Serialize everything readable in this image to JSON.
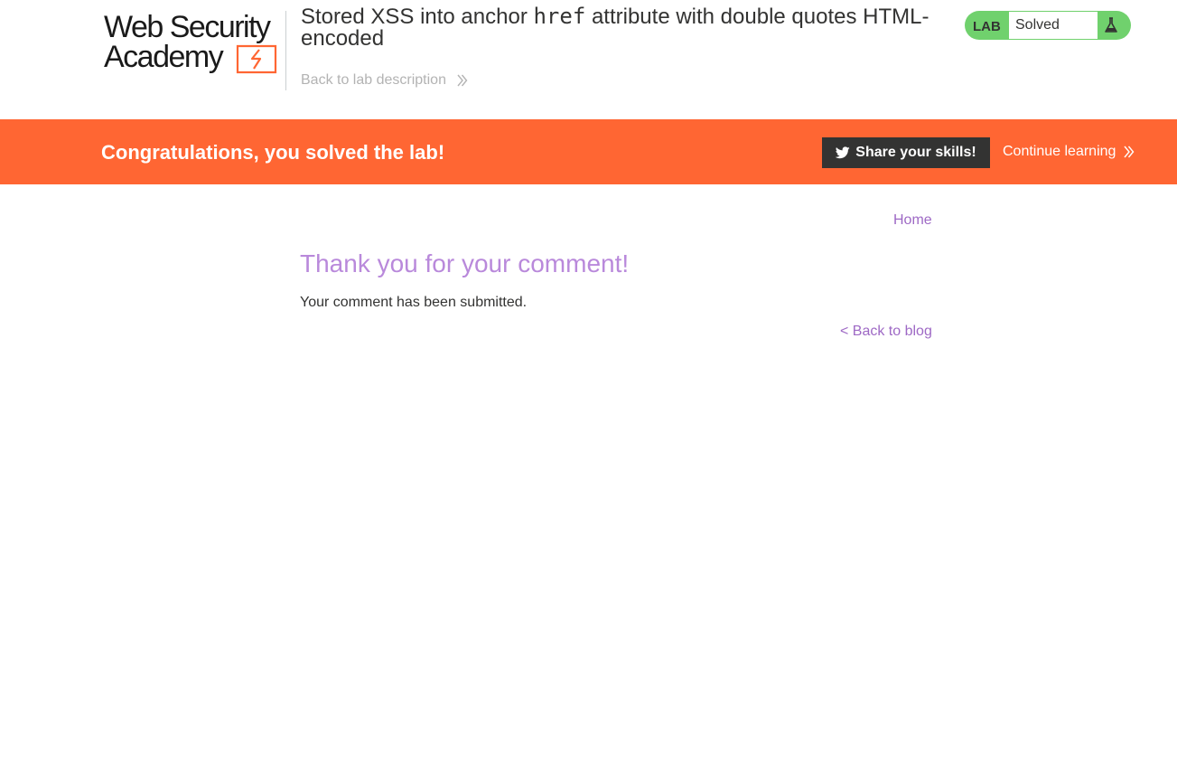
{
  "header": {
    "logo_line1": "Web Security",
    "logo_line2": "Academy",
    "lab_title_prefix": "Stored XSS into anchor ",
    "lab_title_code": "href",
    "lab_title_suffix": " attribute with double quotes HTML-encoded",
    "back_link": "Back to lab description"
  },
  "lab_status": {
    "label": "LAB",
    "value": "Solved",
    "icon": "flask-icon"
  },
  "banner": {
    "message": "Congratulations, you solved the lab!",
    "share_label": "Share your skills!",
    "share_icon": "twitter-icon",
    "continue_label": "Continue learning"
  },
  "nav": {
    "home": "Home"
  },
  "main": {
    "heading": "Thank you for your comment!",
    "message": "Your comment has been submitted.",
    "back_link": "< Back to blog"
  },
  "colors": {
    "banner": "#ff6633",
    "status_green": "#70d16d",
    "link_purple": "#9e69c5",
    "heading_purple": "#b989db",
    "dark": "#333332"
  }
}
